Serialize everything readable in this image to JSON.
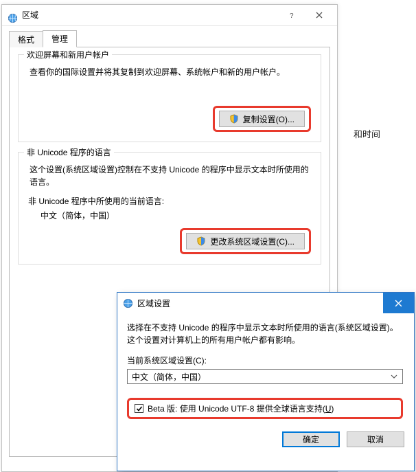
{
  "background": {
    "side_text": "和时间"
  },
  "dlg1": {
    "title": "区域",
    "tabs": {
      "format": "格式",
      "admin": "管理"
    },
    "group_welcome": {
      "title": "欢迎屏幕和新用户帐户",
      "desc": "查看你的国际设置并将其复制到欢迎屏幕、系统帐户和新的用户帐户。",
      "copy_button": "复制设置(O)..."
    },
    "group_nonunicode": {
      "title": "非 Unicode 程序的语言",
      "desc": "这个设置(系统区域设置)控制在不支持 Unicode 的程序中显示文本时所使用的语言。",
      "current_label": "非 Unicode 程序中所使用的当前语言:",
      "current_value": "中文（简体，中国）",
      "change_button": "更改系统区域设置(C)..."
    }
  },
  "dlg2": {
    "title": "区域设置",
    "desc": "选择在不支持 Unicode 的程序中显示文本时所使用的语言(系统区域设置)。这个设置对计算机上的所有用户帐户都有影响。",
    "combo_label": "当前系统区域设置(C):",
    "combo_value": "中文（简体，中国）",
    "beta_prefix": "Beta 版: 使用 Unicode UTF-8 提供全球语言支持(",
    "beta_uline": "U",
    "beta_suffix": ")",
    "buttons": {
      "ok": "确定",
      "cancel": "取消"
    }
  }
}
